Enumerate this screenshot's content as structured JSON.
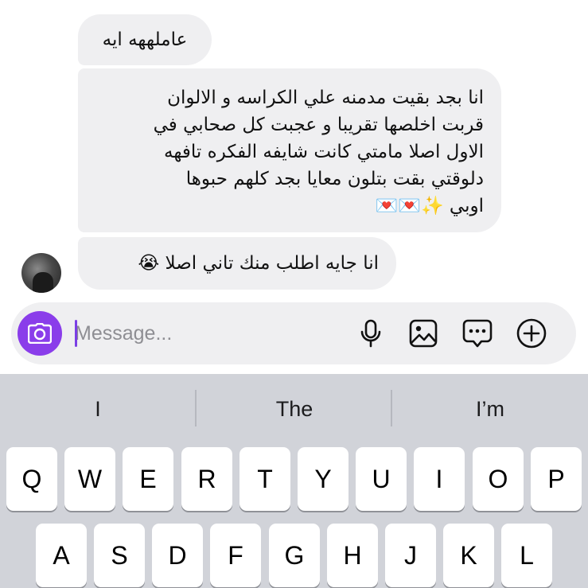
{
  "conversation": {
    "messages": [
      {
        "lines": [
          "عاملههه ايه"
        ]
      },
      {
        "lines": [
          "انا بجد بقيت مدمنه علي الكراسه و الالوان",
          "قربت اخلصها تقريبا و عجبت كل صحابي في",
          "الاول اصلا مامتي كانت شايفه الفكره تافهه",
          "دلوقتي بقت بتلون معايا بجد كلهم حبوها",
          "اوبي ✨💌💌"
        ]
      },
      {
        "lines": [
          "انا جايه اطلب منك تاني اصلا 😭"
        ]
      }
    ]
  },
  "composer": {
    "placeholder": "Message...",
    "icons": [
      "camera-icon",
      "microphone-icon",
      "gallery-icon",
      "sticker-icon",
      "plus-icon"
    ]
  },
  "keyboard": {
    "suggestions": [
      "I",
      "The",
      "I’m"
    ],
    "rows": [
      [
        "Q",
        "W",
        "E",
        "R",
        "T",
        "Y",
        "U",
        "I",
        "O",
        "P"
      ],
      [
        "A",
        "S",
        "D",
        "F",
        "G",
        "H",
        "J",
        "K",
        "L"
      ]
    ]
  },
  "colors": {
    "bubble": "#efeff1",
    "accent": "#8a3dea",
    "keyboard_bg": "#d1d3d9",
    "key_bg": "#ffffff"
  }
}
